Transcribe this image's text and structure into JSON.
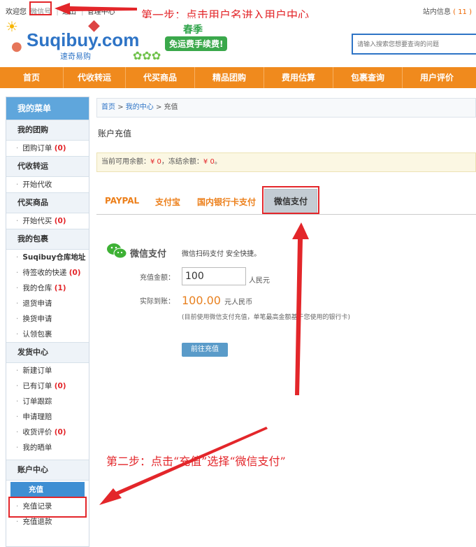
{
  "topbar": {
    "welcome": "欢迎您",
    "username": "微信号",
    "logout": "退出",
    "manage": "管理中心",
    "site_info_label": "站内信息",
    "site_info_count": "( 11 )"
  },
  "annotations": {
    "step1": "第一步：点击用户名进入用户中心",
    "step2": "第二步：点击“充值”选择“微信支付”"
  },
  "header": {
    "logo": "Suqibuy.com",
    "logo_sub": "速奇易购",
    "promo_top": "春季",
    "promo_badge": "免运费手续费!",
    "search_placeholder": "请输入搜索您想要查询的问题"
  },
  "nav": [
    "首页",
    "代收转运",
    "代买商品",
    "精品团购",
    "费用估算",
    "包裹查询",
    "用户评价"
  ],
  "sidebar": {
    "title": "我的菜单",
    "groups": [
      {
        "label": "我的团购",
        "items": [
          {
            "label": "团购订单",
            "count": "(0)"
          }
        ]
      },
      {
        "label": "代收转运",
        "items": [
          {
            "label": "开始代收",
            "count": ""
          }
        ]
      },
      {
        "label": "代买商品",
        "items": [
          {
            "label": "开始代买",
            "count": "(0)"
          }
        ]
      },
      {
        "label": "我的包裹",
        "items": [
          {
            "label": "Suqibuy仓库地址",
            "count": ""
          },
          {
            "label": "待签收的快递",
            "count": "(0)"
          },
          {
            "label": "我的仓库",
            "count": "(1)"
          },
          {
            "label": "退货申请",
            "count": ""
          },
          {
            "label": "换货申请",
            "count": ""
          },
          {
            "label": "认领包裹",
            "count": ""
          }
        ]
      },
      {
        "label": "发货中心",
        "items": [
          {
            "label": "新建订单",
            "count": ""
          },
          {
            "label": "已有订单",
            "count": "(0)"
          },
          {
            "label": "订单跟踪",
            "count": ""
          },
          {
            "label": "申请理赔",
            "count": ""
          },
          {
            "label": "收货评价",
            "count": "(0)"
          },
          {
            "label": "我的晒单",
            "count": ""
          }
        ]
      },
      {
        "label": "账户中心",
        "items": [
          {
            "label": "充值",
            "count": "",
            "active": true
          },
          {
            "label": "充值记录",
            "count": ""
          },
          {
            "label": "充值退款",
            "count": ""
          }
        ]
      }
    ]
  },
  "breadcrumb": {
    "home": "首页",
    "center": "我的中心",
    "current": "充值"
  },
  "page_title": "账户充值",
  "balance": {
    "available_label": "当前可用余额：",
    "available": "¥ 0",
    "frozen_label": "，冻结余额：",
    "frozen": "¥ 0",
    "suffix": "。"
  },
  "tabs": [
    "PAYPAL",
    "支付宝",
    "国内银行卡支付",
    "微信支付"
  ],
  "wechat": {
    "title": "微信支付",
    "desc": "微信扫码支付 安全快捷。",
    "amount_label": "充值金额：",
    "amount_value": "100",
    "amount_unit": "人民元",
    "actual_label": "实际到账：",
    "actual_value": "100.00",
    "actual_unit": "元人民币",
    "note": "(目前使用微信支付充值，单笔最高金额基于您使用的银行卡)",
    "submit": "前往充值"
  },
  "colors": {
    "accent": "#f08a1d",
    "brand": "#2e74c6",
    "annotation": "#e3262a"
  }
}
